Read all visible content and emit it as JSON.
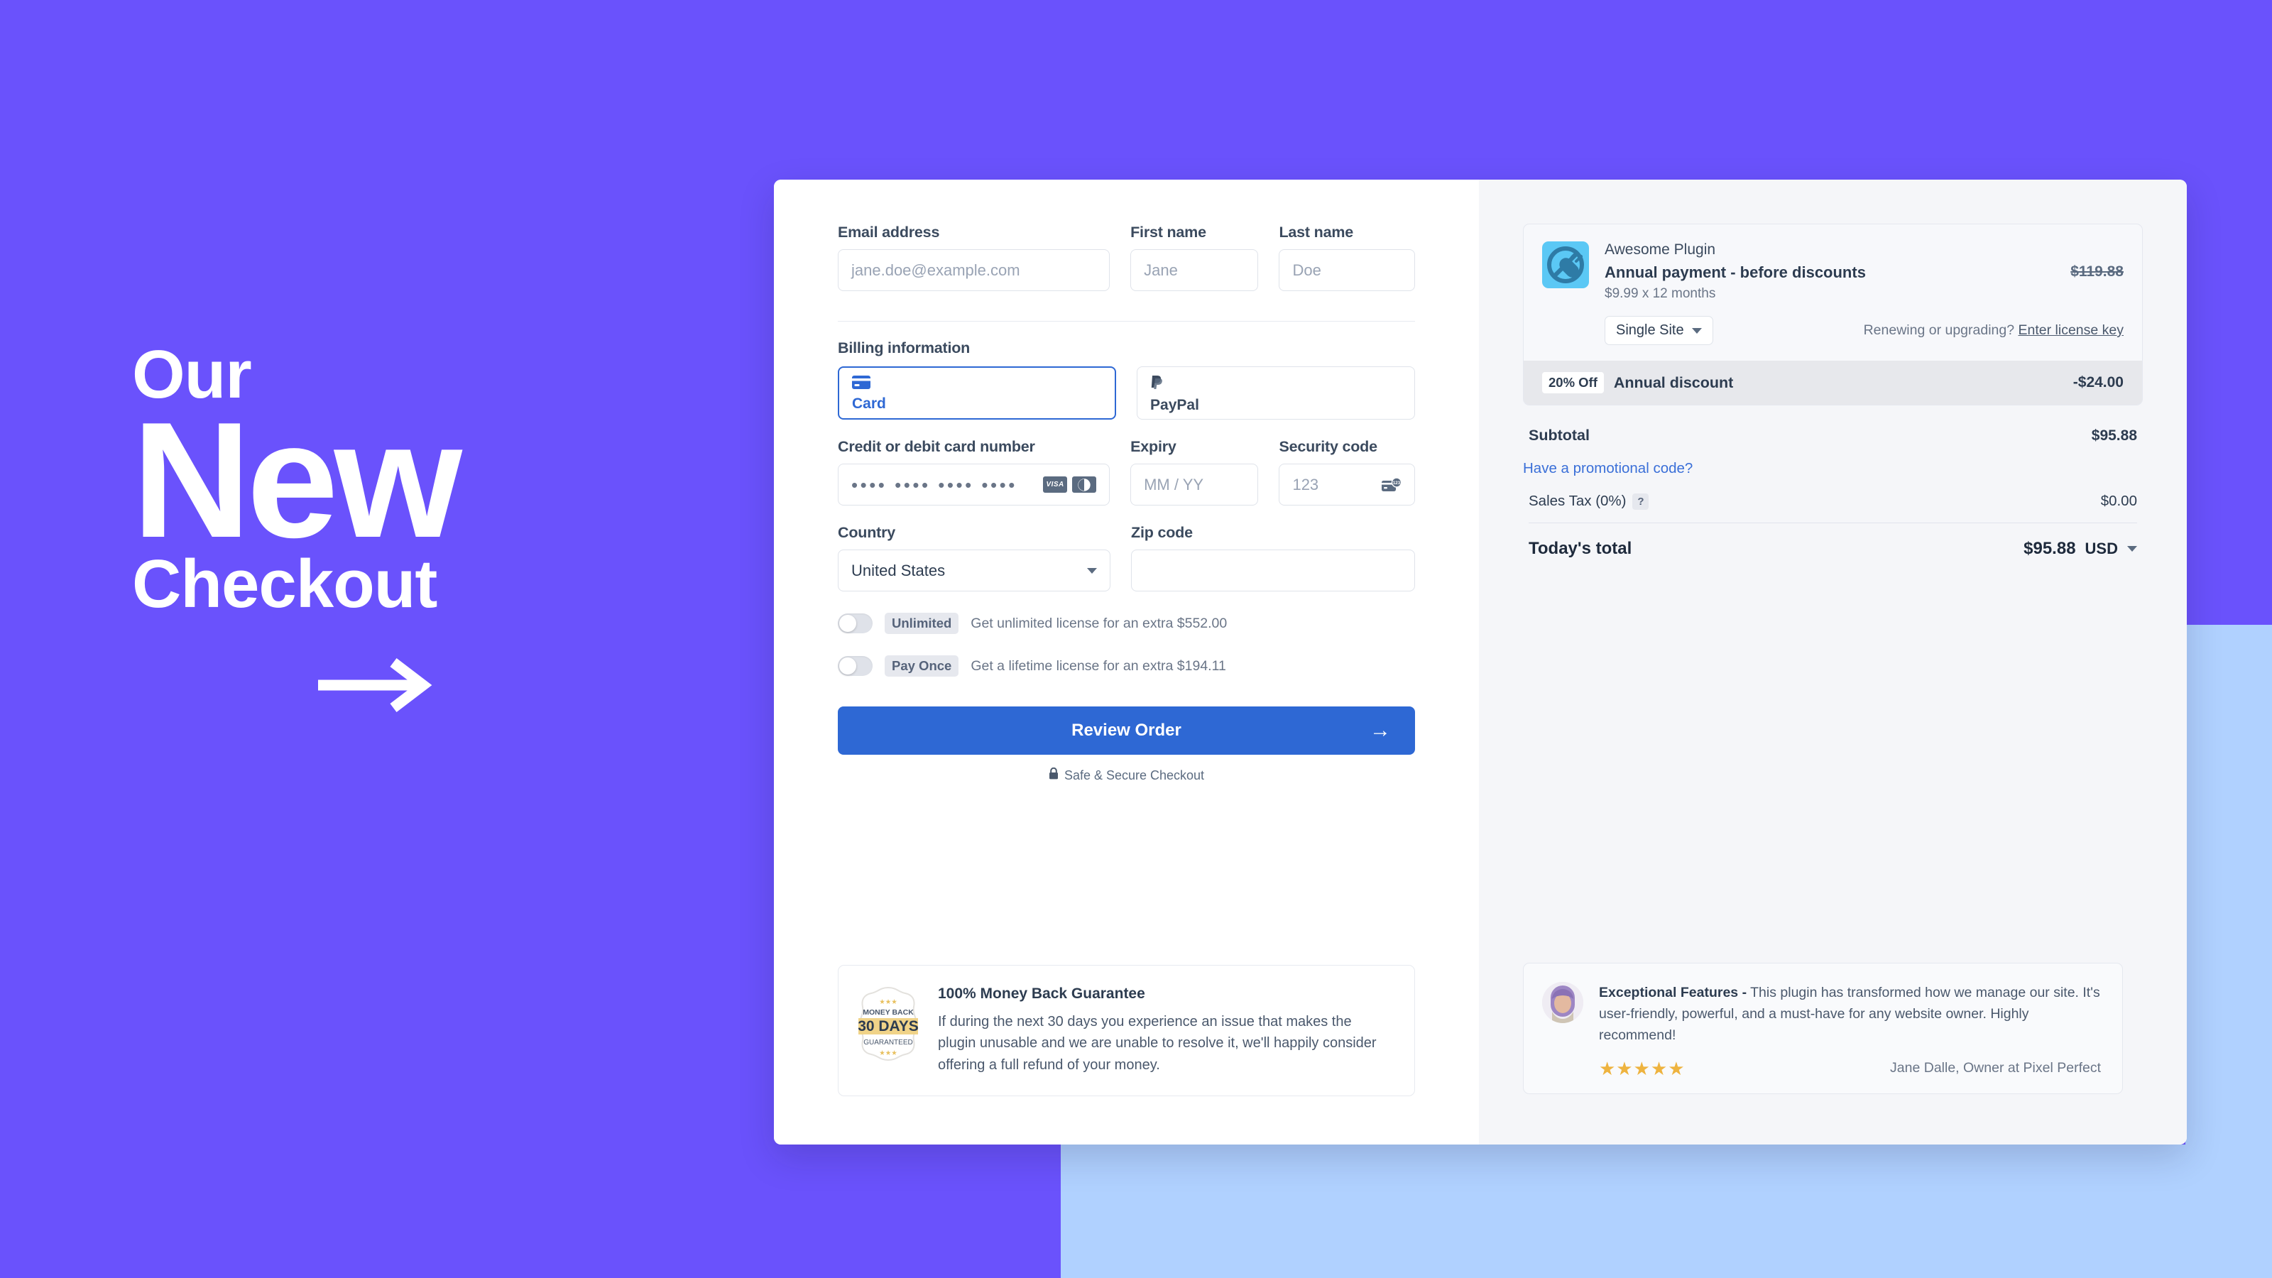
{
  "hero": {
    "line1": "Our",
    "line2": "New",
    "line3": "Checkout",
    "arrow_icon": "arrow-right-icon"
  },
  "theme": {
    "purple": "#6a52fc",
    "light_blue": "#b0d1ff",
    "accent_blue": "#2e68d4",
    "link_blue": "#3a6fd8",
    "star_gold": "#eeb33f"
  },
  "form": {
    "fields": {
      "email": {
        "label": "Email address",
        "placeholder": "jane.doe@example.com",
        "value": ""
      },
      "first_name": {
        "label": "First name",
        "placeholder": "Jane",
        "value": ""
      },
      "last_name": {
        "label": "Last name",
        "placeholder": "Doe",
        "value": ""
      },
      "card_number": {
        "label": "Credit or debit card number",
        "value": "•••• •••• •••• ••••"
      },
      "expiry": {
        "label": "Expiry",
        "placeholder": "MM / YY",
        "value": ""
      },
      "security_code": {
        "label": "Security code",
        "placeholder": "123",
        "value": ""
      },
      "country": {
        "label": "Country",
        "value": "United States"
      },
      "zip": {
        "label": "Zip code",
        "placeholder": "",
        "value": ""
      }
    },
    "billing_heading": "Billing information",
    "payment_methods": [
      {
        "label": "Card",
        "icon": "credit-card-icon",
        "selected": true
      },
      {
        "label": "PayPal",
        "icon": "paypal-icon",
        "selected": false
      }
    ],
    "card_brands": [
      "visa-icon",
      "diners-club-icon"
    ],
    "brand_visa_text": "VISA",
    "upsells": [
      {
        "tag": "Unlimited",
        "description": "Get unlimited license for an extra $552.00",
        "enabled": false
      },
      {
        "tag": "Pay Once",
        "description": "Get a lifetime license for an extra $194.11",
        "enabled": false
      }
    ],
    "submit": {
      "label": "Review Order",
      "arrow_icon": "arrow-right-icon"
    },
    "secure_note": {
      "text": "Safe & Secure Checkout",
      "icon": "lock-icon"
    }
  },
  "guarantee": {
    "title": "100% Money Back Guarantee",
    "body": "If during the next 30 days you experience an issue that makes the plugin unusable and we are unable to resolve it, we'll happily consider offering a full refund of your money.",
    "seal": {
      "top_text": "MONEY BACK",
      "main_text": "30 DAYS",
      "bottom_text": "GUARANTEED",
      "icon": "money-back-seal-icon"
    }
  },
  "summary": {
    "product": {
      "icon": "plugin-icon",
      "name": "Awesome Plugin",
      "title": "Annual payment - before discounts",
      "subtitle": "$9.99 x 12 months",
      "original_price": "$119.88",
      "license_select": {
        "value": "Single Site",
        "icon": "chevron-down-icon"
      },
      "renew_text": "Renewing or upgrading?",
      "renew_link": "Enter license key"
    },
    "discount": {
      "badge": "20% Off",
      "label": "Annual discount",
      "amount": "-$24.00"
    },
    "subtotal": {
      "label": "Subtotal",
      "value": "$95.88"
    },
    "promo_link": "Have a promotional code?",
    "tax": {
      "label": "Sales Tax (0%)",
      "help_icon": "question-mark-icon",
      "value": "$0.00"
    },
    "total": {
      "label": "Today's total",
      "amount": "$95.88",
      "currency": "USD",
      "icon": "chevron-down-icon"
    }
  },
  "testimonial": {
    "headline": "Exceptional Features -",
    "body": " This plugin has transformed how we manage our site. It's user-friendly, powerful, and a must-have for any website owner. Highly recommend!",
    "stars": "★★★★★",
    "author": "Jane Dalle, Owner at Pixel Perfect",
    "avatar_icon": "avatar-icon"
  }
}
